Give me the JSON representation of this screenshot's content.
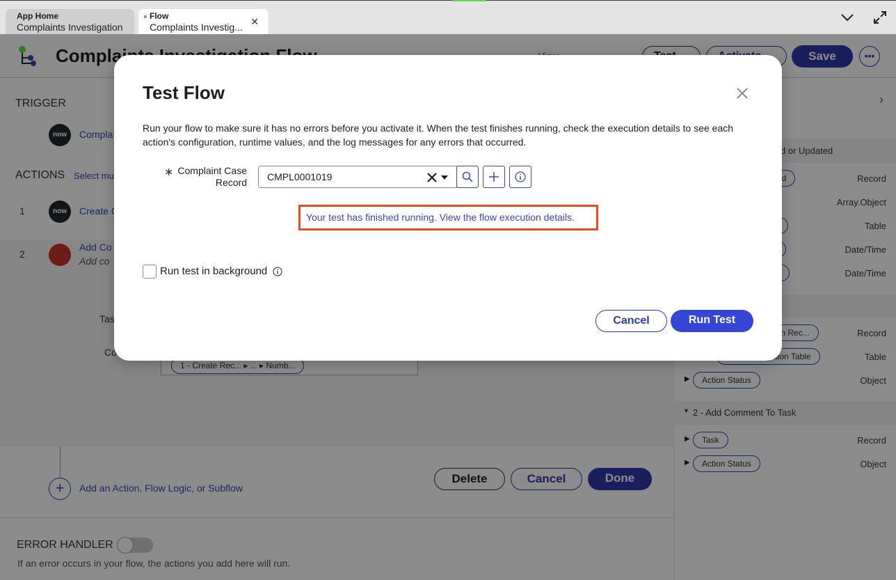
{
  "tabs": [
    {
      "label": "App Home",
      "title": "Complaints Investigation"
    },
    {
      "label": "Flow",
      "title": "Complaints Investig..."
    }
  ],
  "app": {
    "title": "Complaints Investigation Flow",
    "view_label": "View:",
    "test_label": "Test",
    "activate_label": "Activate",
    "save_label": "Save",
    "more_label": "•••"
  },
  "left_pane": {
    "trigger_label": "TRIGGER",
    "trigger_link": "Compla",
    "actions_label": "ACTIONS",
    "select_multiple": "Select mu",
    "now_text": "now",
    "step1_num": "1",
    "step1_link": "Create C",
    "step2_num": "2",
    "step2_link": "Add Co",
    "step2_sub": "Add co",
    "task_label": "Tas",
    "comment_label": "Co",
    "pill_text": "1 - Create Rec... ▸ ... ▸ Numb...",
    "delete_label": "Delete",
    "cancel_label": "Cancel",
    "done_label": "Done",
    "add_action": "Add an Action, Flow Logic, or Subflow",
    "error_handler": "ERROR HANDLER",
    "error_desc": "If an error occurs in your flow, the actions you add here will run."
  },
  "right_pane": {
    "trigger_type": "d or Updated",
    "rows1": [
      {
        "pill": "ord",
        "type": "Record"
      },
      {
        "pill": "",
        "type": "Array.Object"
      },
      {
        "pill": "e",
        "type": "Table"
      },
      {
        "pill": "",
        "type": "Date/Time"
      },
      {
        "pill": "",
        "type": "Date/Time"
      }
    ],
    "rows2": [
      {
        "pill": "ion Rec...",
        "type": "Record"
      },
      {
        "pill": "gation Table",
        "type": "Table"
      },
      {
        "pill": "Action Status",
        "type": "Object"
      }
    ],
    "section3": "2 - Add Comment To Task",
    "rows3": [
      {
        "pill": "Task",
        "type": "Record"
      },
      {
        "pill": "Action Status",
        "type": "Object"
      }
    ]
  },
  "modal": {
    "title": "Test Flow",
    "description": "Run your flow to make sure it has no errors before you activate it. When the test finishes running, check the execution details to see each action's configuration, runtime values, and the log messages for any errors that occurred.",
    "required_mark": "∗",
    "field_label": "Complaint Case Record",
    "field_value": "CMPL0001019",
    "result_link": "Your test has finished running. View the flow execution details.",
    "checkbox_label": "Run test in background",
    "cancel_label": "Cancel",
    "run_label": "Run Test"
  },
  "colors": {
    "primary": "#2d3aa8",
    "run_button": "#3546d6",
    "highlight_border": "#ec4a24",
    "link": "#3546b8"
  }
}
